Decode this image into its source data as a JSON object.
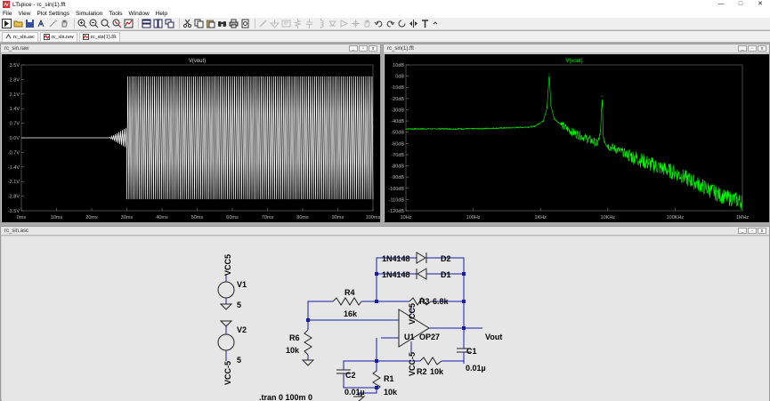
{
  "app": {
    "title": "LTspice - rc_sin(1).fft",
    "window_buttons": [
      "—",
      "□",
      "✕"
    ]
  },
  "menu": [
    "File",
    "View",
    "Plot Settings",
    "Simulation",
    "Tools",
    "Window",
    "Help"
  ],
  "toolbar_icons": [
    "run-icon",
    "open-icon",
    "save-icon",
    "control-panel-icon",
    "wand-icon",
    "hand-icon",
    "zoom-in-icon",
    "zoom-out-icon",
    "zoom-fit-icon",
    "zoom-cancel-icon",
    "autorange-icon",
    "tile-horizontal-icon",
    "tile-vertical-icon",
    "cascade-icon",
    "cut-icon",
    "copy-icon",
    "paste-icon",
    "find-icon",
    "print-icon",
    "print-preview-icon",
    "wire-icon",
    "ground-icon",
    "label-icon",
    "resistor-icon",
    "capacitor-icon",
    "inductor-icon",
    "diode-icon",
    "component-icon",
    "move-icon",
    "drag-icon",
    "undo-icon",
    "redo-icon",
    "rotate-icon",
    "mirror-icon",
    "text-icon",
    "spice-directive-icon"
  ],
  "tabs": [
    {
      "label": "rc_sin.asc",
      "icon": "schematic-icon"
    },
    {
      "label": "rc_sin.raw",
      "icon": "waveform-icon"
    },
    {
      "label": "rc_sin(1).fft",
      "icon": "fft-icon"
    }
  ],
  "panels": {
    "raw": {
      "title": "rc_sin.raw"
    },
    "fft": {
      "title": "rc_sin(1).fft"
    },
    "schematic": {
      "title": "rc_sin.asc"
    }
  },
  "chart_data": [
    {
      "type": "line",
      "title": "V(vout)",
      "x": {
        "range": [
          0,
          100
        ],
        "ticks": [
          "0ms",
          "10ms",
          "20ms",
          "30ms",
          "40ms",
          "50ms",
          "60ms",
          "70ms",
          "80ms",
          "90ms",
          "100ms"
        ]
      },
      "y": {
        "range": [
          -3.5,
          3.5
        ],
        "ticks": [
          "3.5V",
          "2.8V",
          "2.1V",
          "1.4V",
          "0.7V",
          "0.0V",
          "-0.7V",
          "-1.4V",
          "-2.1V",
          "-2.8V",
          "-3.5V"
        ]
      },
      "series": [
        {
          "color": "#ffffff",
          "segments": [
            {
              "t_start": 0,
              "t_end": 25,
              "amplitude": 0.0
            },
            {
              "t_start": 25,
              "t_end": 30,
              "amplitude": 0.5
            },
            {
              "t_start": 30,
              "t_end": 100,
              "amplitude": 2.95,
              "cycles": 120
            }
          ]
        }
      ],
      "grid": false
    },
    {
      "type": "line",
      "title": "V(vout)",
      "title_color": "#00ff00",
      "x": {
        "scale": "log",
        "range": [
          10,
          1000000
        ],
        "ticks": [
          "10Hz",
          "100Hz",
          "1KHz",
          "10KHz",
          "100KHz",
          "1MHz"
        ]
      },
      "y": {
        "range": [
          -120,
          10
        ],
        "ticks": [
          "10dB",
          "0dB",
          "-10dB",
          "-20dB",
          "-30dB",
          "-40dB",
          "-50dB",
          "-60dB",
          "-70dB",
          "-80dB",
          "-90dB",
          "-100dB",
          "-110dB",
          "-120dB"
        ]
      },
      "series": [
        {
          "color": "#00ff00",
          "points": [
            [
              10,
              -47
            ],
            [
              100,
              -47
            ],
            [
              400,
              -46
            ],
            [
              800,
              -45
            ],
            [
              1100,
              -40
            ],
            [
              1250,
              -28
            ],
            [
              1350,
              2
            ],
            [
              1420,
              -26
            ],
            [
              1600,
              -38
            ],
            [
              2200,
              -45
            ],
            [
              3000,
              -50
            ],
            [
              5000,
              -56
            ],
            [
              7000,
              -60
            ],
            [
              7800,
              -52
            ],
            [
              8200,
              -18
            ],
            [
              8600,
              -55
            ],
            [
              10000,
              -62
            ],
            [
              20000,
              -70
            ],
            [
              50000,
              -80
            ],
            [
              100000,
              -86
            ],
            [
              200000,
              -95
            ],
            [
              500000,
              -107
            ],
            [
              1000000,
              -112
            ]
          ]
        }
      ],
      "grid": false
    }
  ],
  "schematic": {
    "components": {
      "d2": {
        "ref": "D2",
        "value": "1N4148"
      },
      "d1": {
        "ref": "D1",
        "value": "1N4148"
      },
      "r4": {
        "ref": "R4",
        "value": "16k"
      },
      "r3": {
        "ref": "R3",
        "value": "6.8k"
      },
      "r6": {
        "ref": "R6",
        "value": "10k"
      },
      "r1": {
        "ref": "R1",
        "value": "10k"
      },
      "r2": {
        "ref": "R2",
        "value": "10k"
      },
      "c1": {
        "ref": "C1",
        "value": "0.01µ"
      },
      "c2": {
        "ref": "C2",
        "value": "0.01µ"
      },
      "u1": {
        "ref": "U1",
        "value": "OP27"
      },
      "v1": {
        "ref": "V1",
        "value": "5"
      },
      "v2": {
        "ref": "V2",
        "value": "5"
      }
    },
    "nets": {
      "vcc5_top": "VCC5",
      "vcc5_mid": "VCC5",
      "vccm5_bot": "VCC-5",
      "vccm5_op": "VCC-5",
      "vout": "Vout"
    },
    "directive": ".tran 0 100m 0"
  },
  "colors": {
    "plot_bg": "#000000",
    "trace_raw": "#ffffff",
    "trace_fft": "#00ff00",
    "wire": "#1a1aaa",
    "schematic_bg": "#ffffff"
  }
}
